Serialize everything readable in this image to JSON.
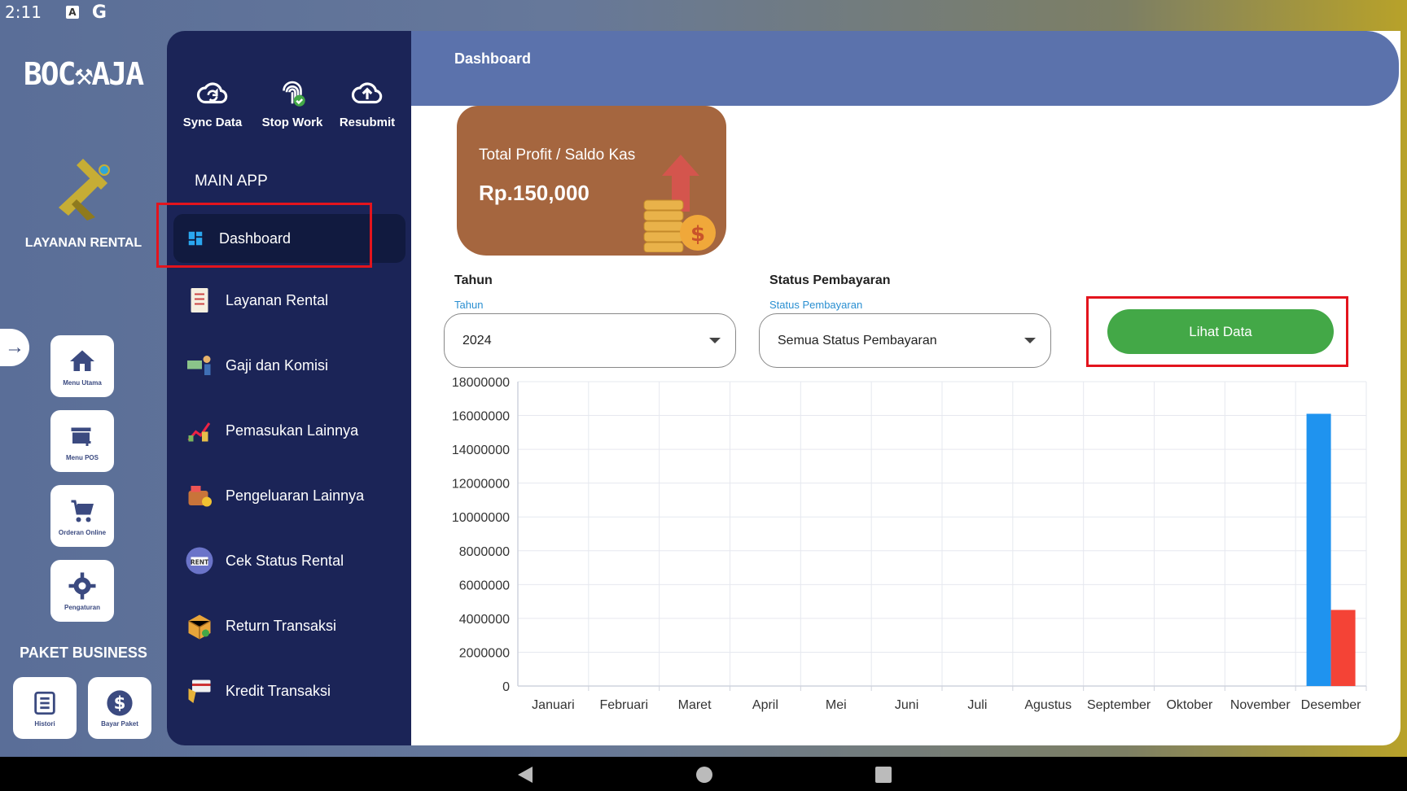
{
  "status_bar": {
    "time": "2:11",
    "icon_a": "A",
    "icon_g": "G"
  },
  "brand": {
    "logo_text": "BOC⚒AJA",
    "app_label": "LAYANAN RENTAL"
  },
  "rail": {
    "items": [
      {
        "label": "Menu Utama",
        "icon": "home-icon"
      },
      {
        "label": "Menu POS",
        "icon": "store-icon"
      },
      {
        "label": "Orderan Online",
        "icon": "cart-icon"
      },
      {
        "label": "Pengaturan",
        "icon": "gear-icon"
      }
    ],
    "paket_title": "PAKET BUSINESS",
    "paket_items": [
      {
        "label": "Histori",
        "icon": "list-icon"
      },
      {
        "label": "Bayar Paket",
        "icon": "dollar-icon"
      }
    ]
  },
  "tools": [
    {
      "label": "Sync Data",
      "icon": "cloud-sync-icon"
    },
    {
      "label": "Stop Work",
      "icon": "fingerprint-icon"
    },
    {
      "label": "Resubmit",
      "icon": "cloud-upload-icon"
    }
  ],
  "nav": {
    "section_title": "MAIN APP",
    "items": [
      {
        "label": "Dashboard",
        "icon": "dashboard-icon",
        "active": true
      },
      {
        "label": "Layanan Rental",
        "icon": "document-icon"
      },
      {
        "label": "Gaji dan Komisi",
        "icon": "salary-icon"
      },
      {
        "label": "Pemasukan Lainnya",
        "icon": "income-icon"
      },
      {
        "label": "Pengeluaran Lainnya",
        "icon": "expense-icon"
      },
      {
        "label": "Cek Status Rental",
        "icon": "rent-sign-icon"
      },
      {
        "label": "Return Transaksi",
        "icon": "return-box-icon"
      },
      {
        "label": "Kredit Transaksi",
        "icon": "credit-card-icon"
      }
    ]
  },
  "header": {
    "title": "Dashboard"
  },
  "profit": {
    "label": "Total Profit / Saldo Kas",
    "value": "Rp.150,000"
  },
  "filters": {
    "tahun": {
      "title": "Tahun",
      "floating_label": "Tahun",
      "value": "2024"
    },
    "status": {
      "title": "Status Pembayaran",
      "floating_label": "Status Pembayaran",
      "value": "Semua Status Pembayaran"
    },
    "submit_label": "Lihat Data"
  },
  "colors": {
    "accent_blue": "#1f93ef",
    "accent_red": "#f44336",
    "nav_bg": "#1b2457",
    "button_green": "#43a847",
    "highlight_red": "#e3141d"
  },
  "chart_data": {
    "type": "bar",
    "categories": [
      "Januari",
      "Februari",
      "Maret",
      "April",
      "Mei",
      "Juni",
      "Juli",
      "Agustus",
      "September",
      "Oktober",
      "November",
      "Desember"
    ],
    "series": [
      {
        "color": "#1f93ef",
        "values": [
          0,
          0,
          0,
          0,
          0,
          0,
          0,
          0,
          0,
          0,
          0,
          16100000
        ]
      },
      {
        "color": "#f44336",
        "values": [
          0,
          0,
          0,
          0,
          0,
          0,
          0,
          0,
          0,
          0,
          0,
          4500000
        ]
      }
    ],
    "yticks": [
      "18000000",
      "16000000",
      "14000000",
      "12000000",
      "10000000",
      "8000000",
      "6000000",
      "4000000",
      "2000000",
      "0"
    ],
    "ylim": [
      0,
      18000000
    ],
    "grid": true
  }
}
